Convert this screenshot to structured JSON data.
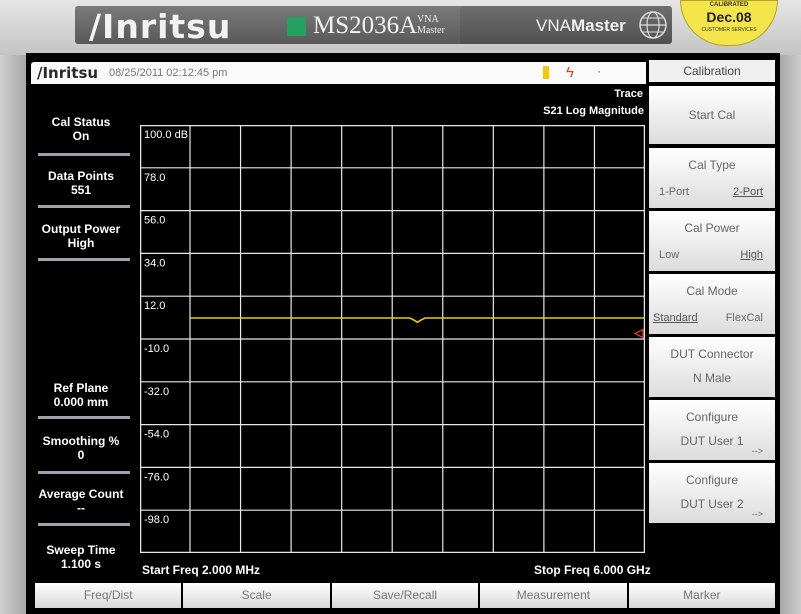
{
  "device": {
    "brand": "/Inritsu",
    "model": "MS2036A",
    "model_sub": "VNA Master",
    "product_prefix": "VNA",
    "product_suffix": "Master",
    "sticker_top": "CALIBRATED",
    "sticker_date": "Dec.08",
    "sticker_bottom": "CUSTOMER SERVICES"
  },
  "screen": {
    "title_logo": "/Inritsu",
    "datetime": "08/25/2011 02:12:45 pm",
    "trace_label": "Trace",
    "measurement_label": "S21 Log Magnitude",
    "start_freq": "Start Freq 2.000 MHz",
    "stop_freq": "Stop Freq 6.000 GHz"
  },
  "left_panel": [
    {
      "label": "Cal Status",
      "value": "On"
    },
    {
      "label": "Data Points",
      "value": "551"
    },
    {
      "label": "Output Power",
      "value": "High"
    },
    {
      "label": "Ref Plane",
      "value": "0.000 mm"
    },
    {
      "label": "Smoothing %",
      "value": "0"
    },
    {
      "label": "Average Count",
      "value": "--"
    },
    {
      "label": "Sweep Time",
      "value": "1.100 s"
    }
  ],
  "chart_data": {
    "type": "line",
    "ylabel": "",
    "xlabel": "",
    "y_ticks": [
      "100.0 dB",
      "78.0",
      "56.0",
      "34.0",
      "12.0",
      "-10.0",
      "-32.0",
      "-54.0",
      "-76.0",
      "-98.0"
    ],
    "ylim": [
      -120,
      100
    ],
    "xlim": [
      2,
      6000
    ],
    "x_unit": "MHz",
    "grid": true,
    "series": [
      {
        "color": "#e6d000",
        "x": [
          2,
          1800,
          2900,
          2960,
          3000,
          3040,
          3100,
          4200,
          6000
        ],
        "y": [
          0.8,
          0.8,
          0.8,
          -0.4,
          -1.4,
          -0.4,
          0.8,
          0.8,
          0.8
        ]
      }
    ],
    "reference_level": 0
  },
  "softkey_menu": {
    "title": "Calibration",
    "start_cal": "Start Cal",
    "cal_type": {
      "label": "Cal Type",
      "opt1": "1-Port",
      "opt2": "2-Port"
    },
    "cal_power": {
      "label": "Cal Power",
      "opt1": "Low",
      "opt2": "High"
    },
    "cal_mode": {
      "label": "Cal Mode",
      "opt1": "Standard",
      "opt2": "FlexCal"
    },
    "dut_connector": {
      "label": "DUT Connector",
      "value": "N Male"
    },
    "configure_1": {
      "label": "Configure",
      "value": "DUT User 1",
      "arrow": "-->"
    },
    "configure_2": {
      "label": "Configure",
      "value": "DUT User 2",
      "arrow": "-->"
    }
  },
  "bottom_menu": [
    "Freq/Dist",
    "Scale",
    "Save/Recall",
    "Measurement",
    "Marker"
  ],
  "colors": {
    "trace": "#e6d000",
    "grid": "#e8e8e8",
    "reference_marker": "#e03a2a"
  }
}
